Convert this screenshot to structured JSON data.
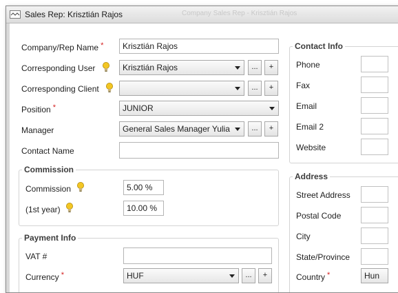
{
  "window": {
    "title": "Sales Rep: Krisztián Rajos",
    "background_title": "Company Sales Rep - Krisztián Rajos"
  },
  "form": {
    "company_rep_name": {
      "label": "Company/Rep Name",
      "value": "Krisztián Rajos"
    },
    "corresponding_user": {
      "label": "Corresponding User",
      "value": "Krisztián Rajos"
    },
    "corresponding_client": {
      "label": "Corresponding Client",
      "value": ""
    },
    "position": {
      "label": "Position",
      "value": "JUNIOR"
    },
    "manager": {
      "label": "Manager",
      "value": "General Sales Manager Yulia"
    },
    "contact_name": {
      "label": "Contact Name",
      "value": ""
    },
    "required_mark": "*",
    "ellipsis_label": "...",
    "add_label": "+"
  },
  "commission": {
    "title": "Commission",
    "commission": {
      "label": "Commission",
      "value": "5.00 %"
    },
    "first_year": {
      "label": "(1st year)",
      "value": "10.00 %"
    }
  },
  "payment": {
    "title": "Payment Info",
    "vat": {
      "label": "VAT #",
      "value": ""
    },
    "currency": {
      "label": "Currency",
      "value": "HUF"
    }
  },
  "contact_info": {
    "title": "Contact Info",
    "phone": "Phone",
    "fax": "Fax",
    "email": "Email",
    "email2": "Email 2",
    "website": "Website"
  },
  "address": {
    "title": "Address",
    "street": "Street Address",
    "postal": "Postal Code",
    "city": "City",
    "state": "State/Province",
    "country": "Country",
    "country_value": "Hun"
  },
  "colors": {
    "required": "#d42020",
    "bulb": "#f3c623",
    "title_bar": "#dcdcdc"
  },
  "icons": [
    "app-icon",
    "lightbulb-icon",
    "dropdown-arrow-icon"
  ]
}
